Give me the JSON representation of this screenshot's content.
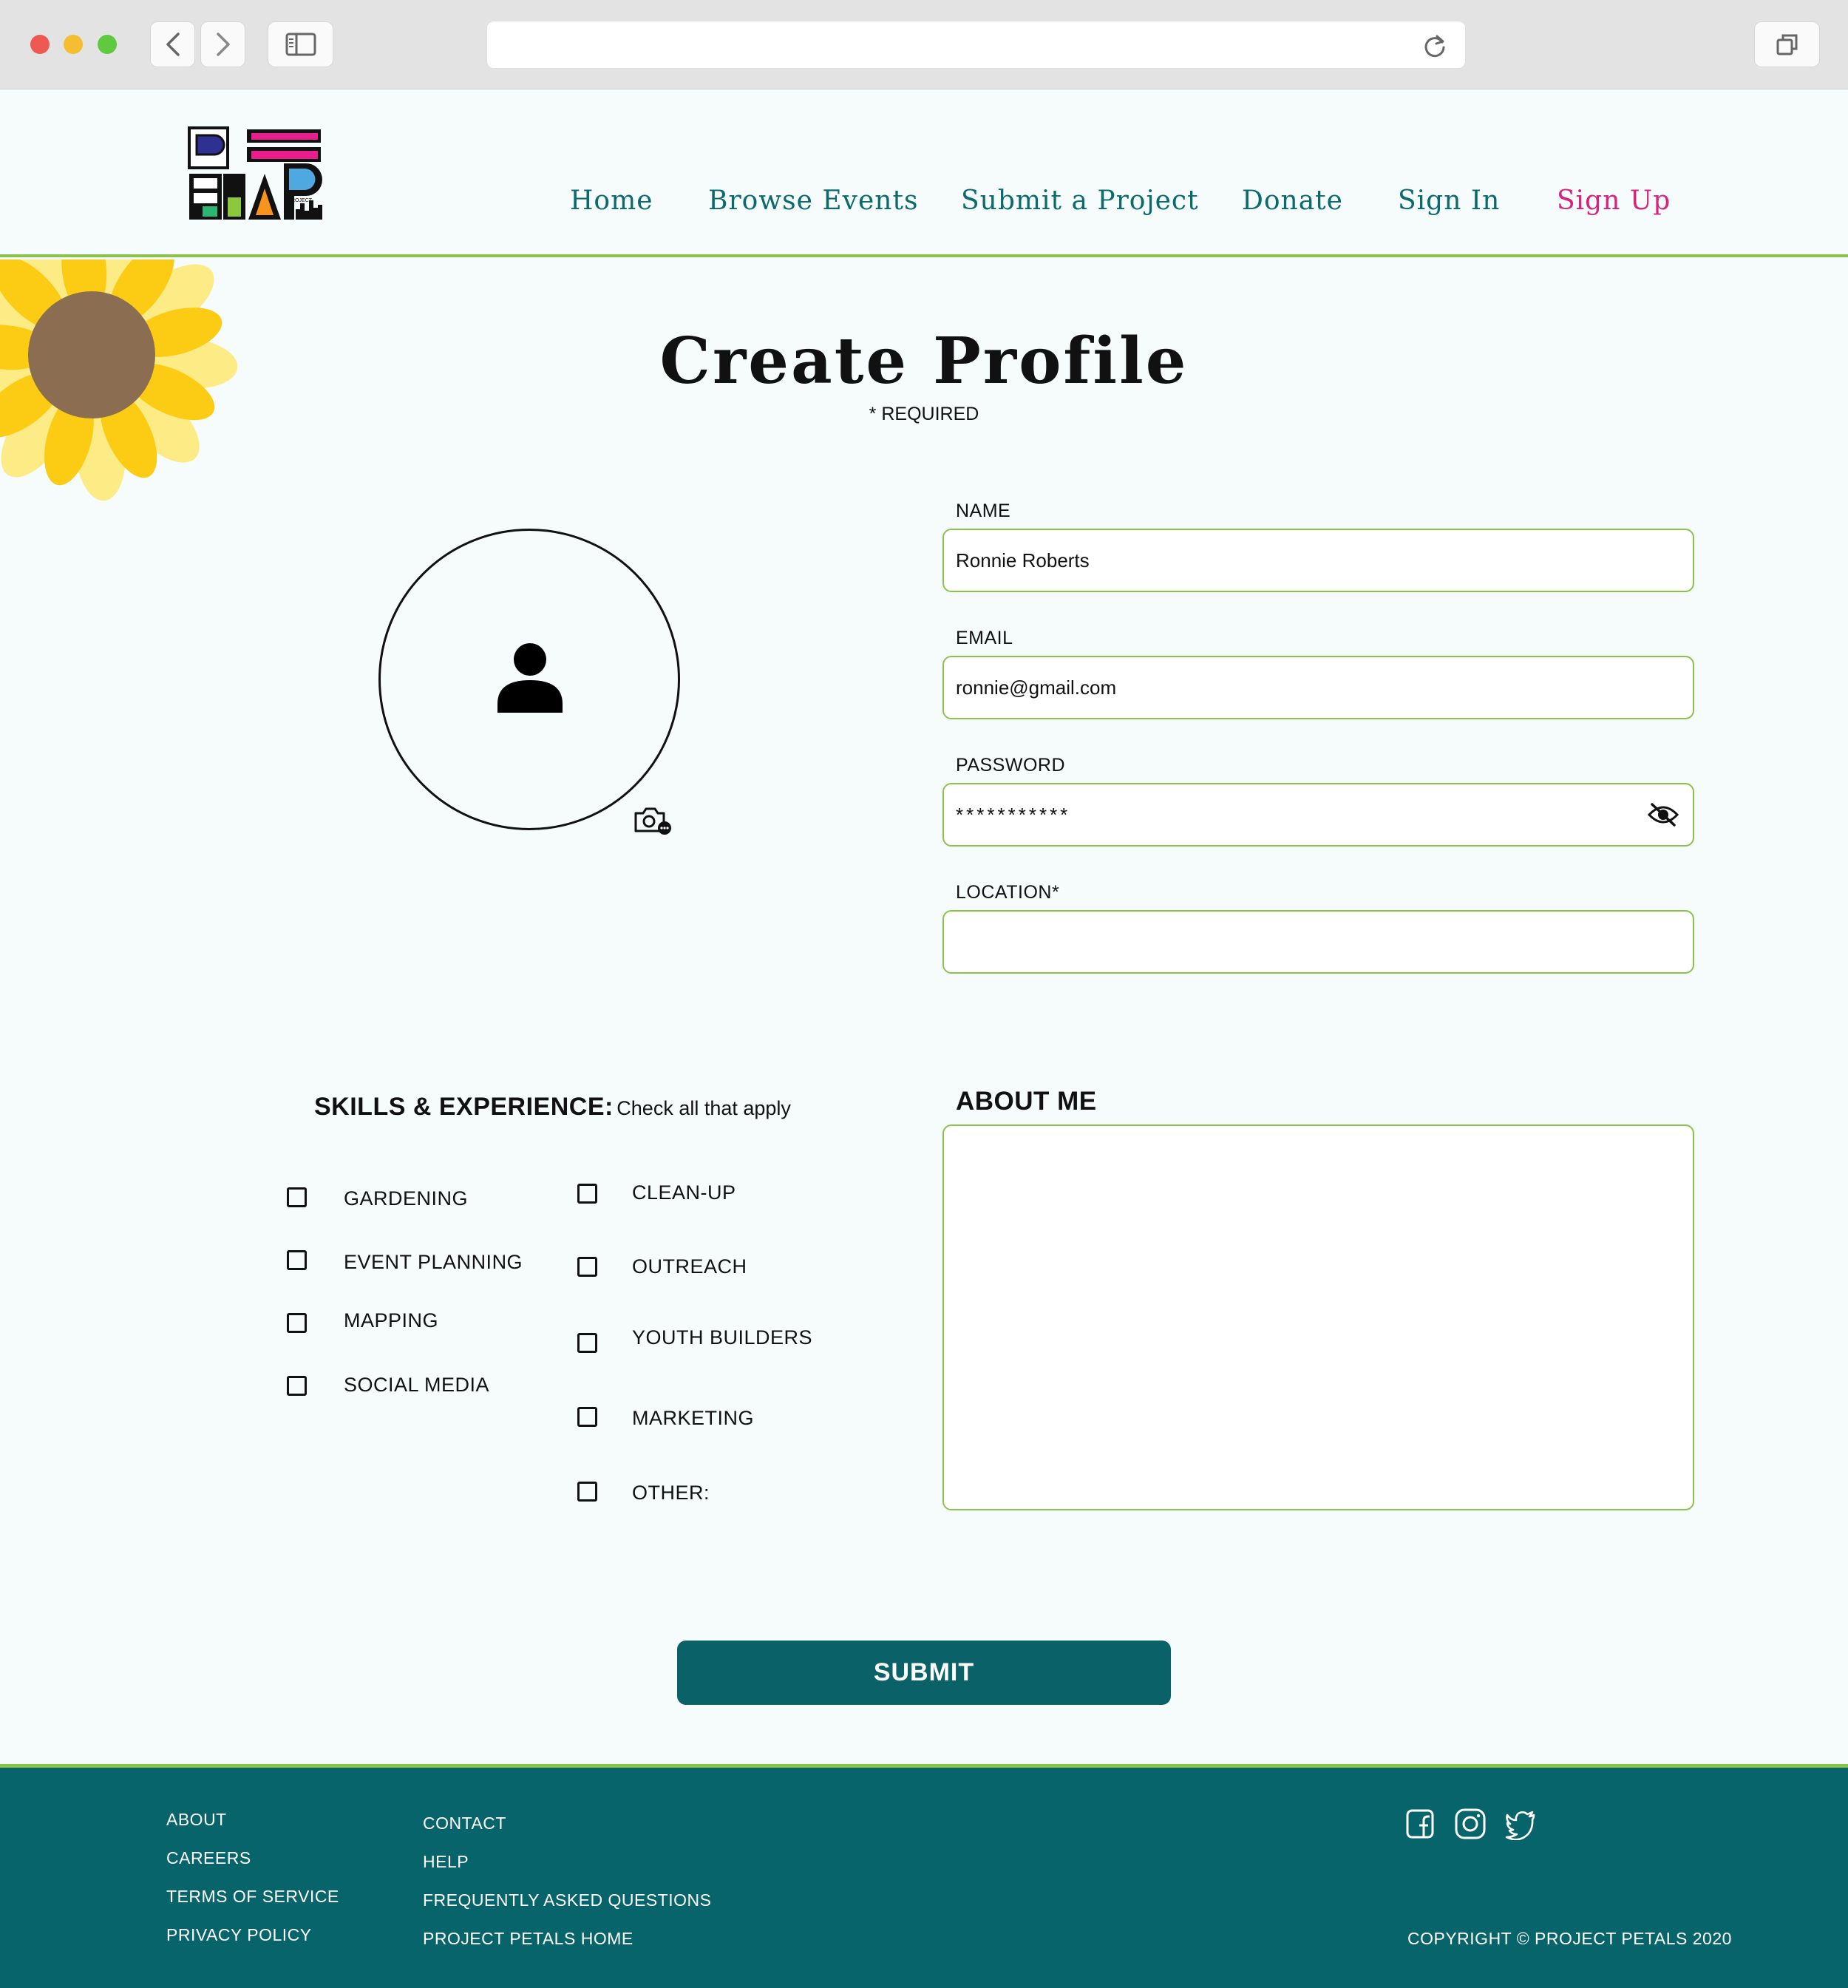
{
  "browser": {
    "url": "",
    "traffic_lights": {
      "close": "#ee5a52",
      "minimize": "#f5bd2f",
      "maximize": "#5fc93f"
    }
  },
  "header": {
    "nav": [
      {
        "label": "Home"
      },
      {
        "label": "Browse Events"
      },
      {
        "label": "Submit a Project"
      },
      {
        "label": "Donate"
      },
      {
        "label": "Sign In"
      },
      {
        "label": "Sign Up"
      }
    ]
  },
  "page": {
    "title": "Create Profile",
    "required_note": "* REQUIRED"
  },
  "form": {
    "name": {
      "label": "NAME",
      "value": "Ronnie Roberts"
    },
    "email": {
      "label": "EMAIL",
      "value": "ronnie@gmail.com"
    },
    "password": {
      "label": "PASSWORD",
      "value": "***********"
    },
    "location": {
      "label": "LOCATION*",
      "value": ""
    }
  },
  "skills": {
    "heading": "SKILLS & EXPERIENCE:",
    "subheading": "Check all that apply",
    "items": [
      {
        "label": "GARDENING",
        "checked": false
      },
      {
        "label": "EVENT PLANNING",
        "checked": false
      },
      {
        "label": "MAPPING",
        "checked": false
      },
      {
        "label": "SOCIAL MEDIA",
        "checked": false
      },
      {
        "label": "CLEAN-UP",
        "checked": false
      },
      {
        "label": "OUTREACH",
        "checked": false
      },
      {
        "label": "YOUTH BUILDERS",
        "checked": false
      },
      {
        "label": "MARKETING",
        "checked": false
      },
      {
        "label": "OTHER:",
        "checked": false
      }
    ]
  },
  "about": {
    "heading": "ABOUT ME",
    "value": ""
  },
  "submit_label": "SUBMIT",
  "footer": {
    "col1": [
      "ABOUT",
      "CAREERS",
      "TERMS OF SERVICE",
      "PRIVACY POLICY"
    ],
    "col2": [
      "CONTACT",
      "HELP",
      "FREQUENTLY ASKED QUESTIONS",
      "PROJECT PETALS HOME"
    ],
    "social": [
      "facebook-icon",
      "instagram-icon",
      "twitter-icon"
    ],
    "copyright": "COPYRIGHT © PROJECT PETALS 2020"
  },
  "colors": {
    "accent_teal": "#0a6a6e",
    "signup_pink": "#d6247a",
    "field_border_green": "#8bc34a",
    "footer_bg": "#07646b",
    "sunflower_petal": "#fccc14",
    "sunflower_center": "#8b6e52"
  }
}
